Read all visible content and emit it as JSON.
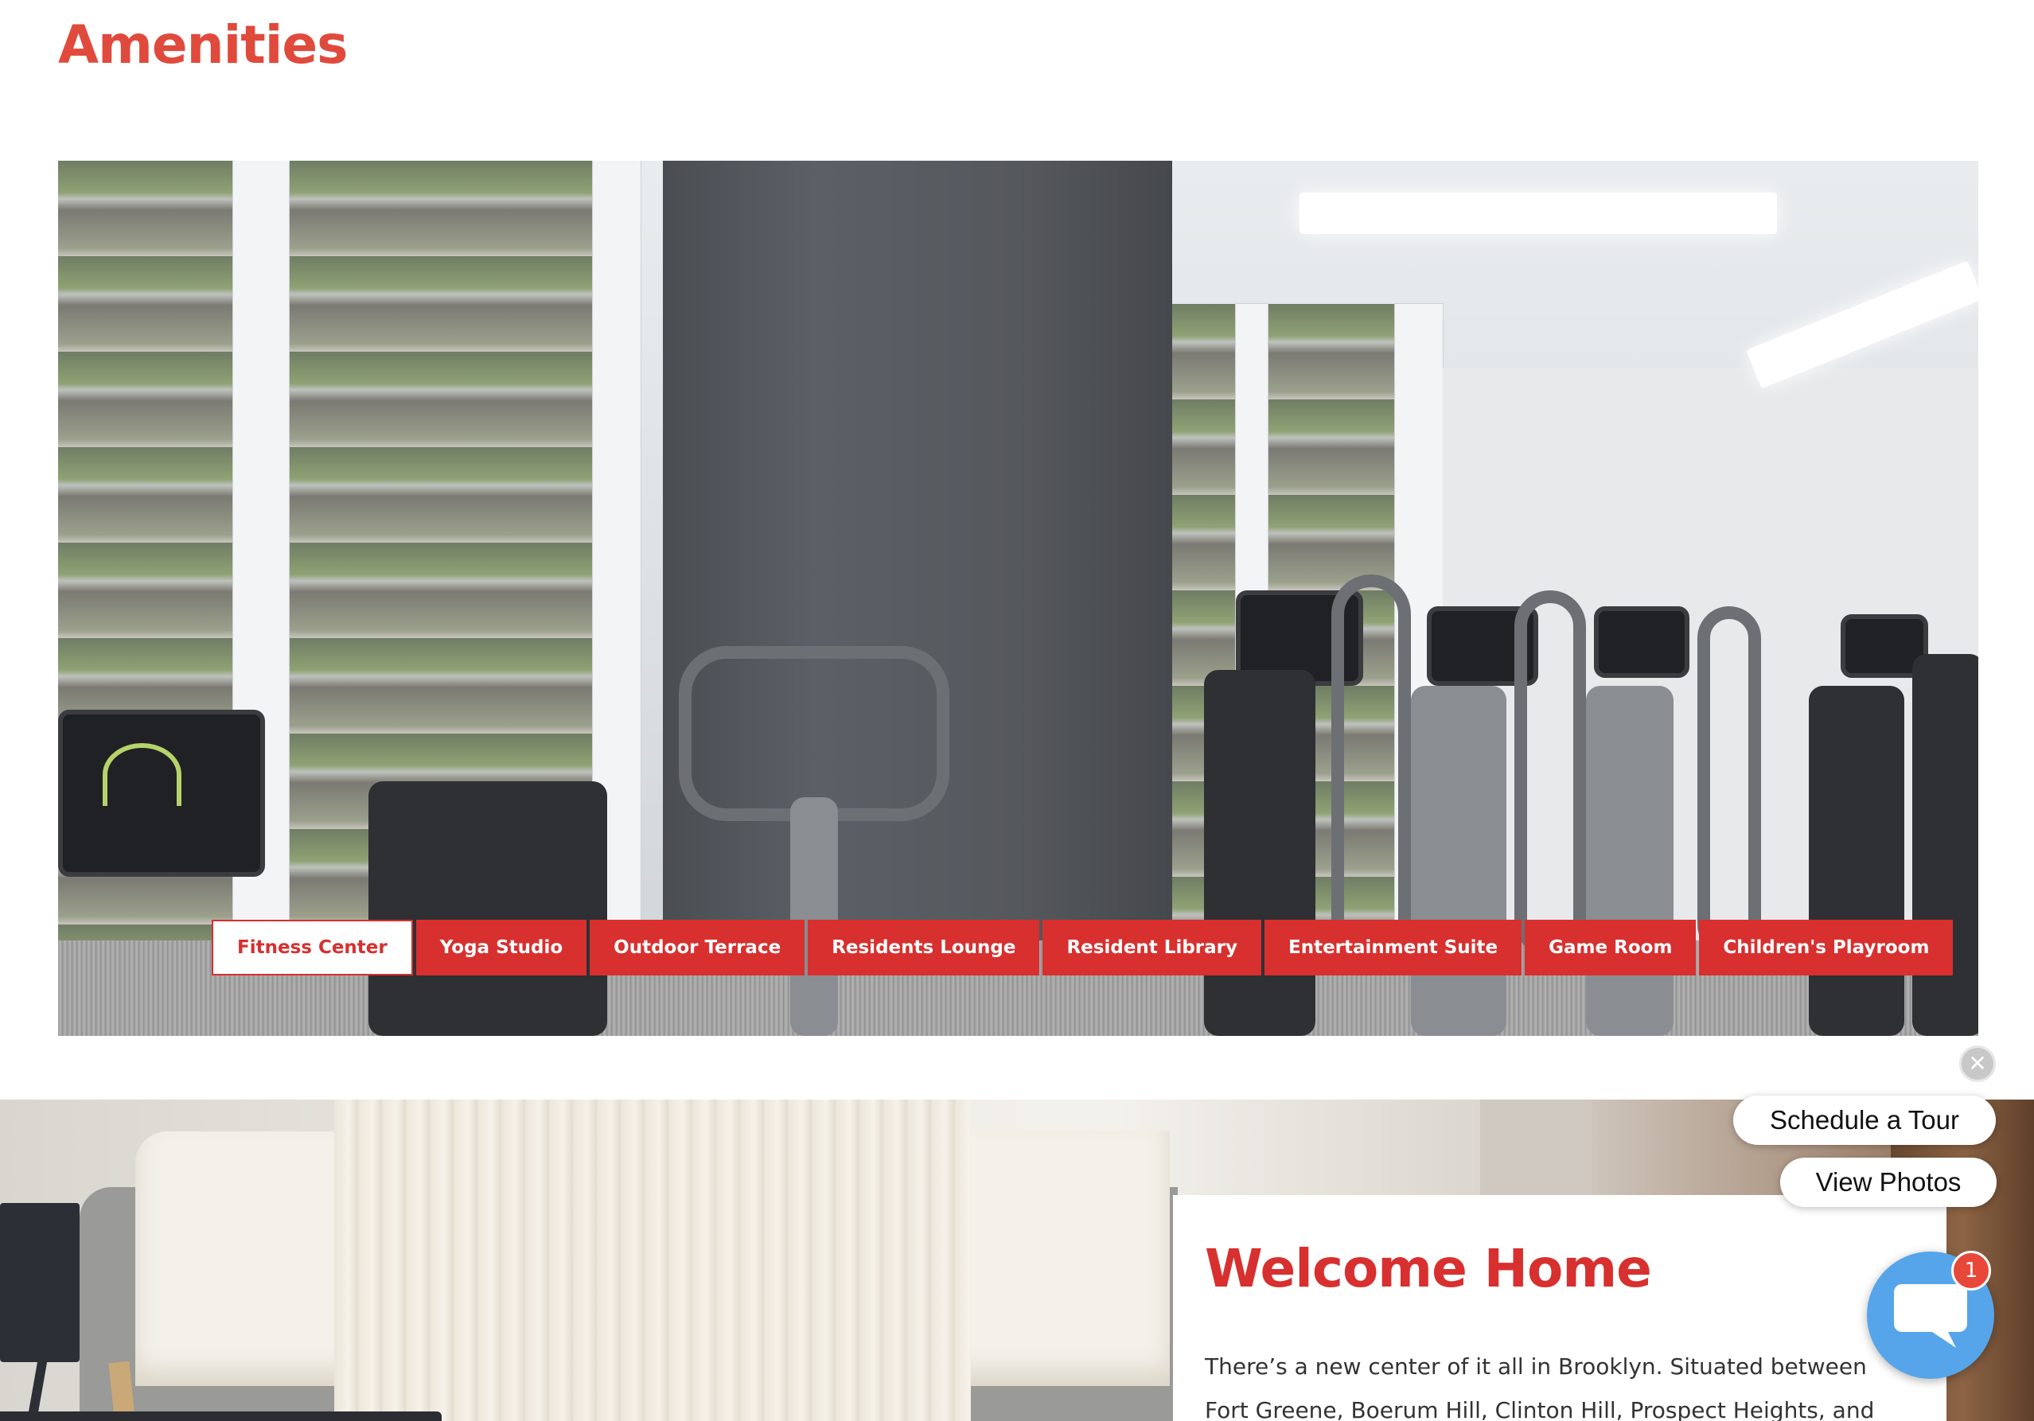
{
  "page": {
    "heading": "Amenities"
  },
  "amenities": {
    "photo_subject": "fitness-center-photo",
    "tabs": [
      {
        "label": "Fitness Center",
        "active": true
      },
      {
        "label": "Yoga Studio",
        "active": false
      },
      {
        "label": "Outdoor Terrace",
        "active": false
      },
      {
        "label": "Residents Lounge",
        "active": false
      },
      {
        "label": "Resident Library",
        "active": false
      },
      {
        "label": "Entertainment Suite",
        "active": false
      },
      {
        "label": "Game Room",
        "active": false
      },
      {
        "label": "Children's Playroom",
        "active": false
      }
    ]
  },
  "welcome": {
    "title": "Welcome Home",
    "text": "There’s a new center of it all in Brooklyn. Situated between Fort Greene, Boerum Hill, Clinton Hill, Prospect Heights, and Park Slope,"
  },
  "widgets": {
    "close_icon": "close-icon",
    "close_glyph": "✕",
    "schedule_tour": "Schedule a Tour",
    "view_photos": "View Photos",
    "chat_icon": "chat-bubble-icon",
    "chat_badge_count": "1"
  },
  "colors": {
    "brand_red": "#d7302f",
    "heading_red": "#e04a3c",
    "chat_blue": "#56a5ea"
  }
}
